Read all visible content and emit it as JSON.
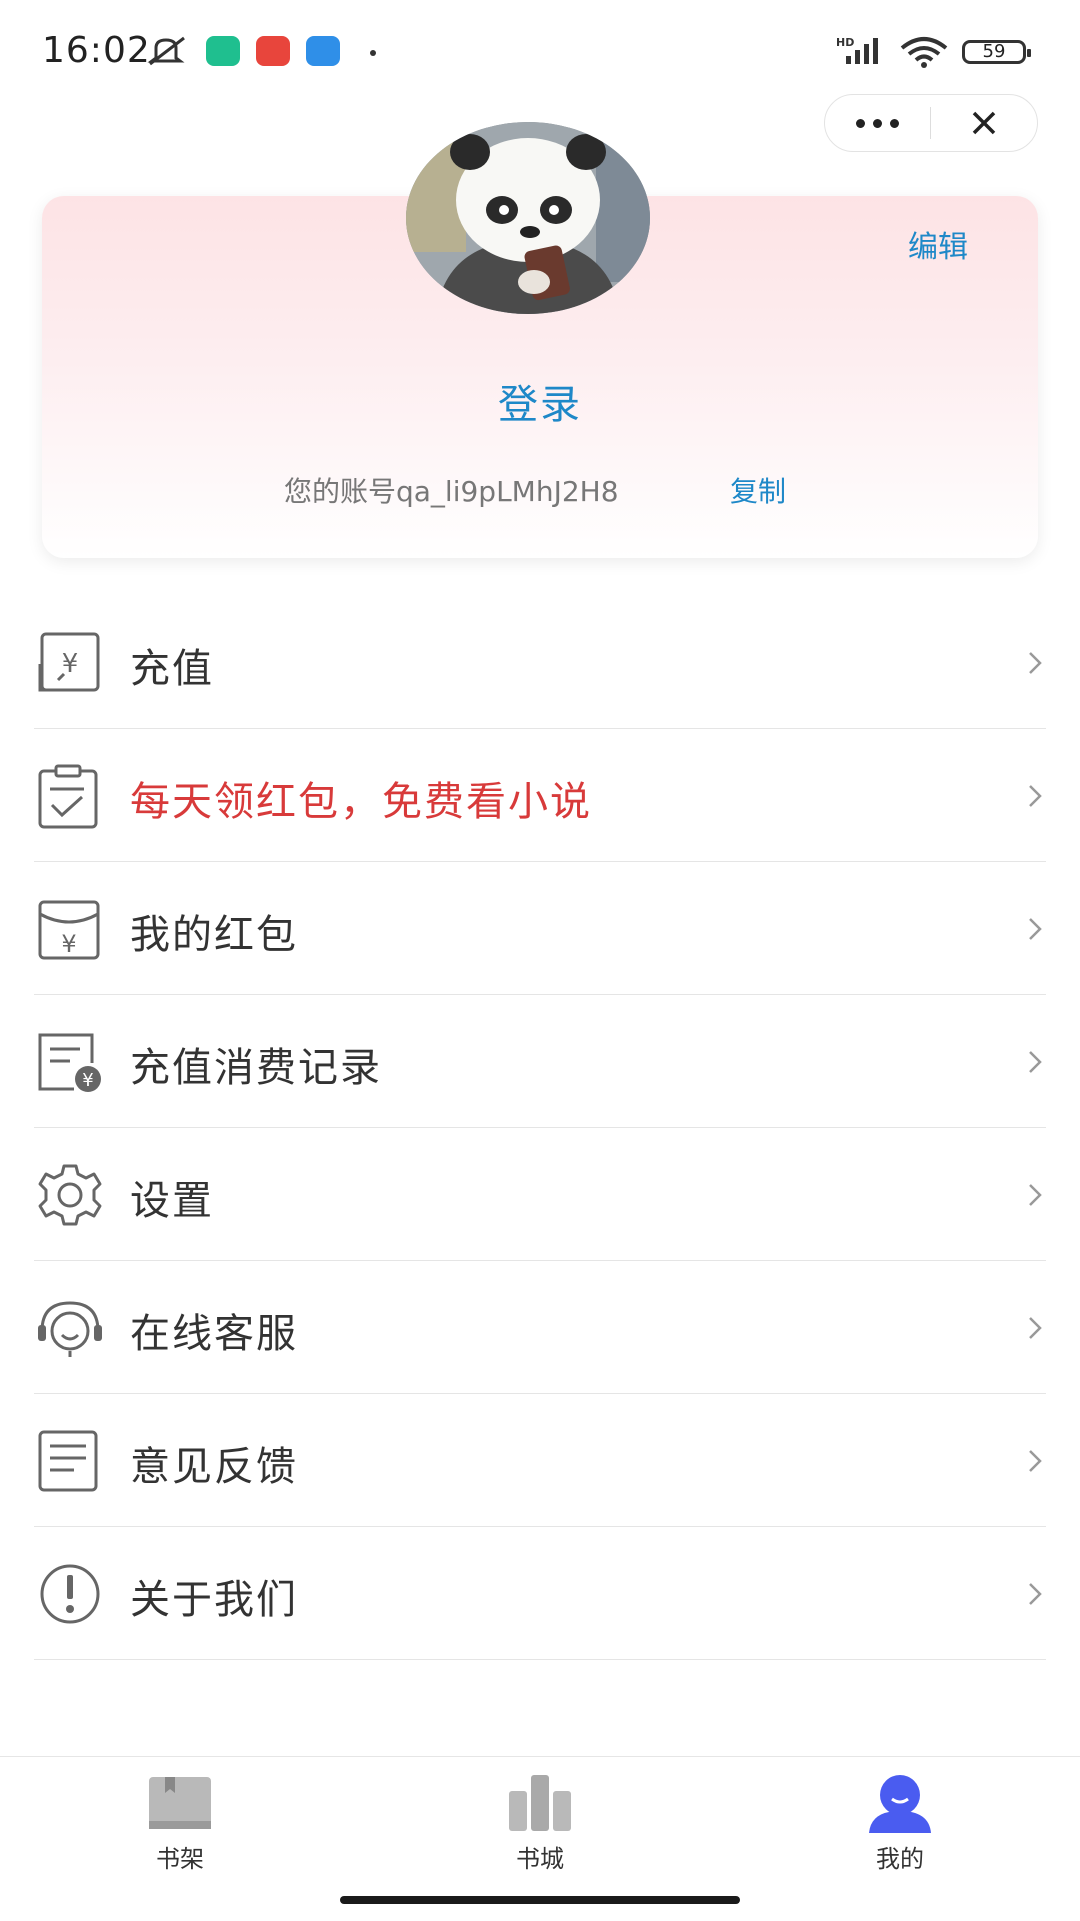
{
  "status_bar": {
    "time": "16:02",
    "battery": "59"
  },
  "capsule": {
    "more_icon": "more-dots-icon",
    "close_icon": "close-x-icon"
  },
  "profile": {
    "edit_label": "编辑",
    "login_label": "登录",
    "account_text": "您的账号qa_li9pLMhJ2H8",
    "copy_label": "复制"
  },
  "menu": {
    "items": [
      {
        "label": "充值",
        "icon": "recharge-yuan-icon",
        "highlight": false
      },
      {
        "label": "每天领红包，免费看小说",
        "icon": "checklist-icon",
        "highlight": true
      },
      {
        "label": "我的红包",
        "icon": "red-envelope-icon",
        "highlight": false
      },
      {
        "label": "充值消费记录",
        "icon": "record-bill-icon",
        "highlight": false
      },
      {
        "label": "设置",
        "icon": "gear-icon",
        "highlight": false
      },
      {
        "label": "在线客服",
        "icon": "headset-icon",
        "highlight": false
      },
      {
        "label": "意见反馈",
        "icon": "feedback-doc-icon",
        "highlight": false
      },
      {
        "label": "关于我们",
        "icon": "info-exclamation-icon",
        "highlight": false
      }
    ]
  },
  "tabbar": {
    "tabs": [
      {
        "label": "书架",
        "icon": "bookshelf-icon",
        "active": false
      },
      {
        "label": "书城",
        "icon": "bookstore-icon",
        "active": false
      },
      {
        "label": "我的",
        "icon": "profile-user-icon",
        "active": true
      }
    ]
  },
  "colors": {
    "accent_blue": "#1e88c8",
    "highlight_red": "#d83a3a",
    "active_tab": "#4a5cf0"
  }
}
